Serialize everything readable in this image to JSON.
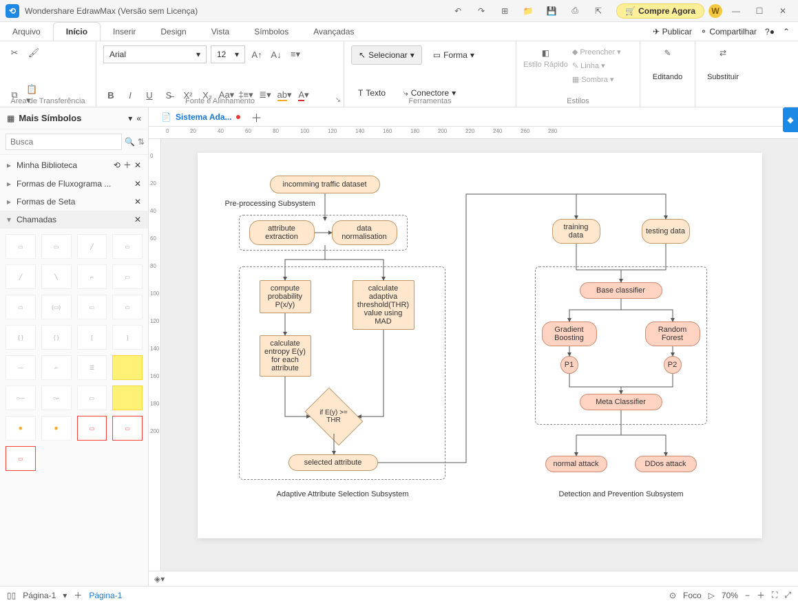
{
  "title": "Wondershare EdrawMax (Versão sem Licença)",
  "buy": "Compre Agora",
  "menu": {
    "arquivo": "Arquivo",
    "inicio": "Início",
    "inserir": "Inserir",
    "design": "Design",
    "vista": "Vista",
    "simbolos": "Símbolos",
    "avancadas": "Avançadas",
    "publicar": "Publicar",
    "compartilhar": "Compartilhar"
  },
  "ribbon": {
    "clipboard_label": "Área de Transferência",
    "font_label": "Fonte e Alinhamento",
    "tools_label": "Ferramentas",
    "styles_label": "Estilos",
    "editing_label": "Editando",
    "replace_label": "Substituir",
    "font_name": "Arial",
    "font_size": "12",
    "select": "Selecionar",
    "shape": "Forma",
    "text": "Texto",
    "connector": "Conectore",
    "quick_style": "Estilo Rápido",
    "fill": "Preencher",
    "line": "Linha",
    "shadow": "Sombra"
  },
  "sidebar": {
    "more": "Mais Símbolos",
    "search_ph": "Busca",
    "lib1": "Minha Biblioteca",
    "lib2": "Formas de Fluxograma ...",
    "lib3": "Formas de Seta",
    "lib4": "Chamadas"
  },
  "doc_tab": "Sistema Ada...",
  "diagram": {
    "n1": "incomming traffic dataset",
    "sub1": "Pre-processing Subsystem",
    "n2": "attribute extraction",
    "n3": "data normalisation",
    "n4": "compute probability P(x/y)",
    "n5": "calculate adaptiva threshold(THR) value using MAD",
    "n6": "calculate entropy E(y) for each attribute",
    "n7": "if E(y) >= THR",
    "n8": "selected attribute",
    "sub2": "Adaptive Attribute Selection Subsystem",
    "n9": "training data",
    "n10": "testing data",
    "n11": "Base classifier",
    "n12": "Gradient Boosting",
    "n13": "Random Forest",
    "n14": "P1",
    "n15": "P2",
    "n16": "Meta Classifier",
    "n17": "normal attack",
    "n18": "DDos attack",
    "sub3": "Detection and Prevention Subsystem"
  },
  "colorbar": [
    "#000",
    "#444",
    "#666",
    "#888",
    "#aaa",
    "#ccc",
    "#eee",
    "#fff",
    "#b71c1c",
    "#d32f2f",
    "#f44336",
    "#e57373",
    "#ffcdd2",
    "#880e4f",
    "#c2185b",
    "#e91e63",
    "#f06292",
    "#f8bbd0",
    "#4a148c",
    "#7b1fa2",
    "#9c27b0",
    "#ba68c8",
    "#e1bee7",
    "#1a237e",
    "#303f9f",
    "#3f51b5",
    "#7986cb",
    "#c5cae9",
    "#0d47a1",
    "#1976d2",
    "#2196f3",
    "#64b5f6",
    "#bbdefb",
    "#006064",
    "#0097a7",
    "#00bcd4",
    "#4dd0e1",
    "#b2ebf2",
    "#1b5e20",
    "#388e3c",
    "#4caf50",
    "#81c784",
    "#c8e6c9",
    "#827717",
    "#afb42b",
    "#cddc39",
    "#dce775",
    "#f0f4c3",
    "#f57f17",
    "#fbc02d",
    "#ffeb3b",
    "#fff176",
    "#fff9c4",
    "#e65100",
    "#f57c00",
    "#ff9800",
    "#ffb74d",
    "#ffe0b2",
    "#bf360c",
    "#e64a19",
    "#ff5722",
    "#ff8a65",
    "#ffccbc",
    "#3e2723",
    "#5d4037",
    "#795548",
    "#a1887f",
    "#d7ccc8"
  ],
  "status": {
    "page": "Página-1",
    "page2": "Página-1",
    "focus": "Foco",
    "zoom": "70%"
  }
}
